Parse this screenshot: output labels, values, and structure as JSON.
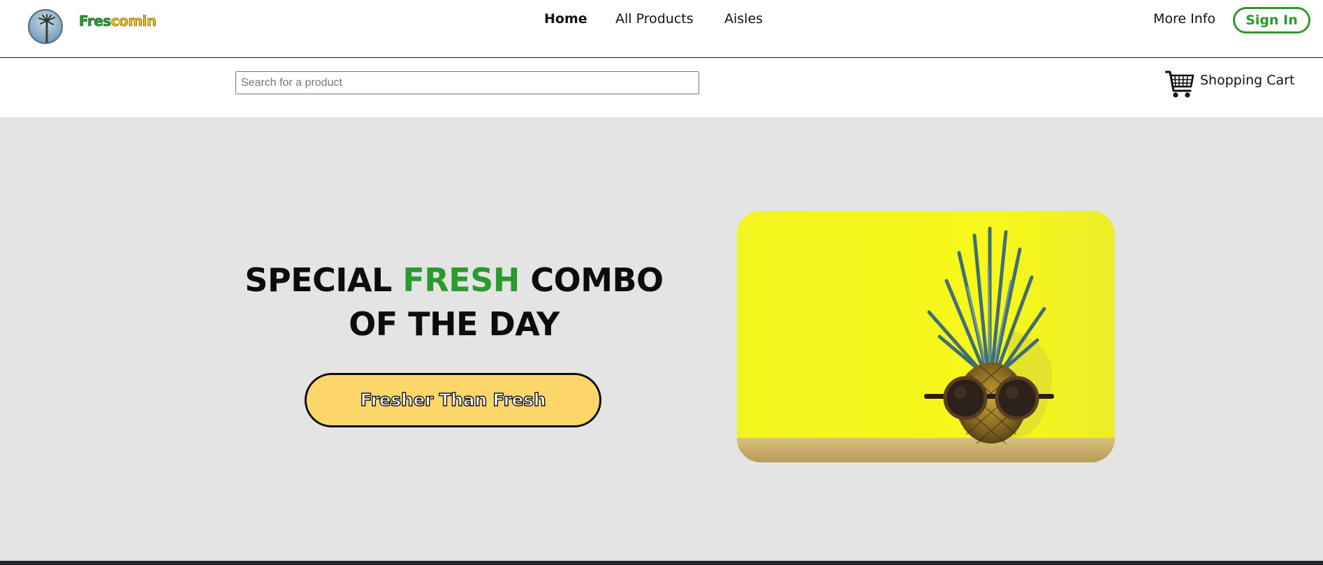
{
  "header": {
    "brand_part1": "Fres",
    "brand_part2": "comin",
    "logo_icon": "palm-tree-logo",
    "nav": [
      {
        "label": "Home",
        "active": true
      },
      {
        "label": "All Products",
        "active": false
      },
      {
        "label": "Aisles",
        "active": false
      }
    ],
    "more_info": "More Info",
    "sign_in": "Sign In"
  },
  "subbar": {
    "search_placeholder": "Search for a product",
    "search_value": "",
    "cart_icon": "shopping-cart-icon",
    "cart_label": "Shopping Cart"
  },
  "hero": {
    "title_before": "SPECIAL",
    "title_accent": "FRESH",
    "title_after": "COMBO OF THE DAY",
    "cta_label": "Fresher Than Fresh",
    "image": "pineapple-with-sunglasses-photo"
  },
  "colors": {
    "accent_green": "#2a9a2e",
    "brand_yellow": "#f2c21a",
    "cta_fill": "#fdd66a",
    "hero_bg": "#e4e4e4",
    "photo_bg": "#f4f61c"
  }
}
